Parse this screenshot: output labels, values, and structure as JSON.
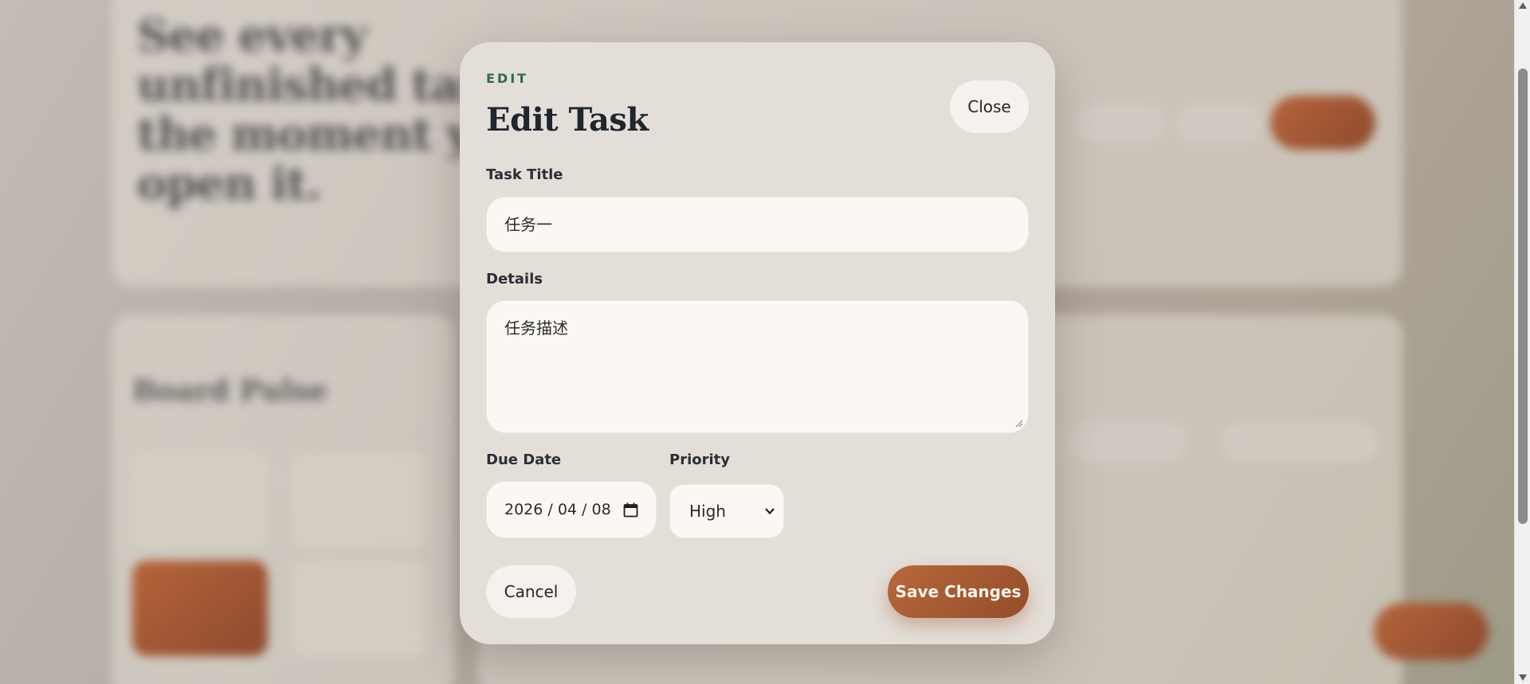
{
  "modal": {
    "eyebrow": "EDIT",
    "title": "Edit Task",
    "close_label": "Close",
    "task_title_label": "Task Title",
    "task_title_value": "任务一",
    "details_label": "Details",
    "details_value": "任务描述",
    "due_date_label": "Due Date",
    "due_date_value": "2026 / 04 / 08",
    "priority_label": "Priority",
    "priority_value": "High",
    "cancel_label": "Cancel",
    "save_label": "Save Changes"
  },
  "background": {
    "hero_title": "See every unfinished task the moment you open it.",
    "board_title": "Board Pulse"
  },
  "colors": {
    "accent": "#b8683b",
    "eyebrow_green": "#2f6b4c",
    "modal_bg": "#e4ded8",
    "field_bg": "#fbf8f3"
  },
  "icons": {
    "date": "calendar-icon",
    "select": "chevron-down-icon",
    "resize": "resize-grip-icon"
  }
}
